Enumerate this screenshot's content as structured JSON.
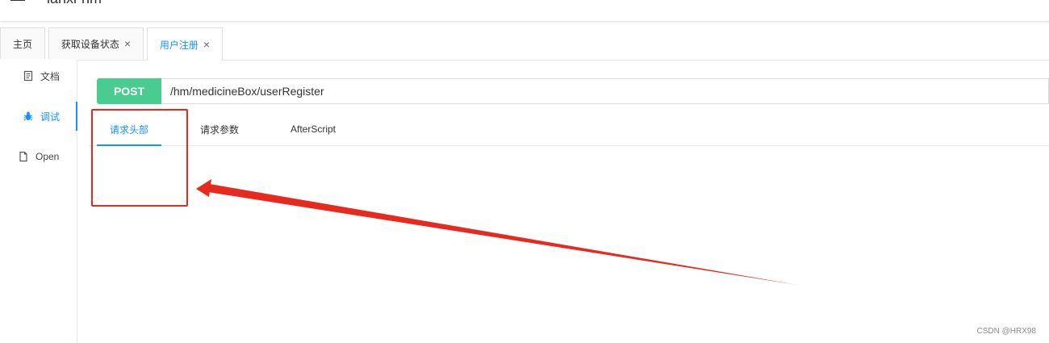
{
  "header": {
    "app_title": "lanxi-hm"
  },
  "tabs": [
    {
      "label": "主页",
      "closable": false
    },
    {
      "label": "获取设备状态",
      "closable": true
    },
    {
      "label": "用户注册",
      "closable": true,
      "active": true
    }
  ],
  "tab_close_glyph": "×",
  "sidebar": {
    "items": [
      {
        "label": "文档",
        "icon": "document-icon"
      },
      {
        "label": "调试",
        "icon": "bug-icon",
        "active": true
      },
      {
        "label": "Open",
        "icon": "file-icon"
      }
    ]
  },
  "request": {
    "method": "POST",
    "url": "/hm/medicineBox/userRegister"
  },
  "subtabs": [
    {
      "label": "请求头部",
      "active": true
    },
    {
      "label": "请求参数"
    },
    {
      "label": "AfterScript"
    }
  ],
  "colors": {
    "accent": "#1890ff",
    "post_method": "#49cc90",
    "annotation_red": "#e8291e"
  },
  "watermark": "CSDN @HRX98"
}
